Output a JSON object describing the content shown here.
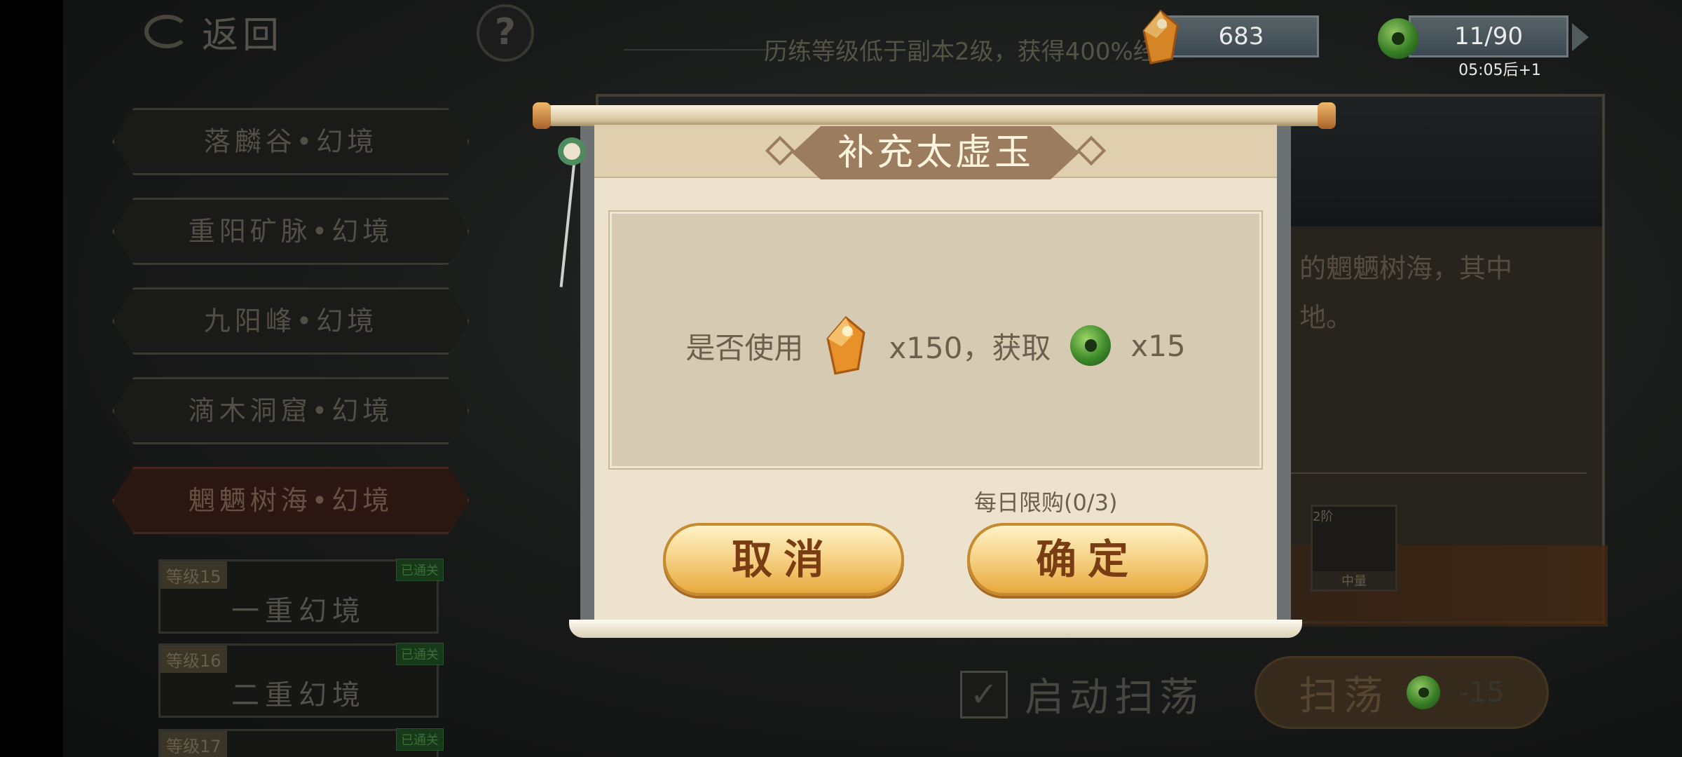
{
  "topbar": {
    "back_label": "返回",
    "help_symbol": "?",
    "notice": "历练等级低于副本2级，获得400%经",
    "crystal_amount": "683",
    "jade_amount": "11/90",
    "jade_timer": "05:05后+1"
  },
  "dungeons": [
    {
      "label": "落麟谷•幻境"
    },
    {
      "label": "重阳矿脉•幻境"
    },
    {
      "label": "九阳峰•幻境"
    },
    {
      "label": "滴木洞窟•幻境"
    },
    {
      "label": "魍魉树海•幻境"
    }
  ],
  "stages": [
    {
      "level": "等级15",
      "name": "一重幻境",
      "status": "已通关"
    },
    {
      "level": "等级16",
      "name": "二重幻境",
      "status": "已通关"
    },
    {
      "level": "等级17",
      "status": "已通关"
    }
  ],
  "detail": {
    "desc_line1": "的魍魉树海，其中",
    "desc_line2": "地。",
    "item_tier": "2阶",
    "item_weight": "中量"
  },
  "bottom": {
    "auto_sweep_label": "启动扫荡",
    "check_symbol": "✓",
    "sweep_label": "扫荡",
    "sweep_cost": "-15"
  },
  "modal": {
    "title": "补充太虚玉",
    "question_prefix": "是否使用",
    "cost_text": "x150，获取",
    "gain_text": "x15",
    "daily_limit": "每日限购(0/3)",
    "cancel_label": "取消",
    "confirm_label": "确定"
  },
  "icons": {
    "crystal": "orange-crystal-icon",
    "jade": "green-jade-icon"
  },
  "colors": {
    "crystal": "#e8902a",
    "jade": "#3e8a2a",
    "button_gold": "#f7d48a",
    "title_plate": "#9c7c5e"
  }
}
